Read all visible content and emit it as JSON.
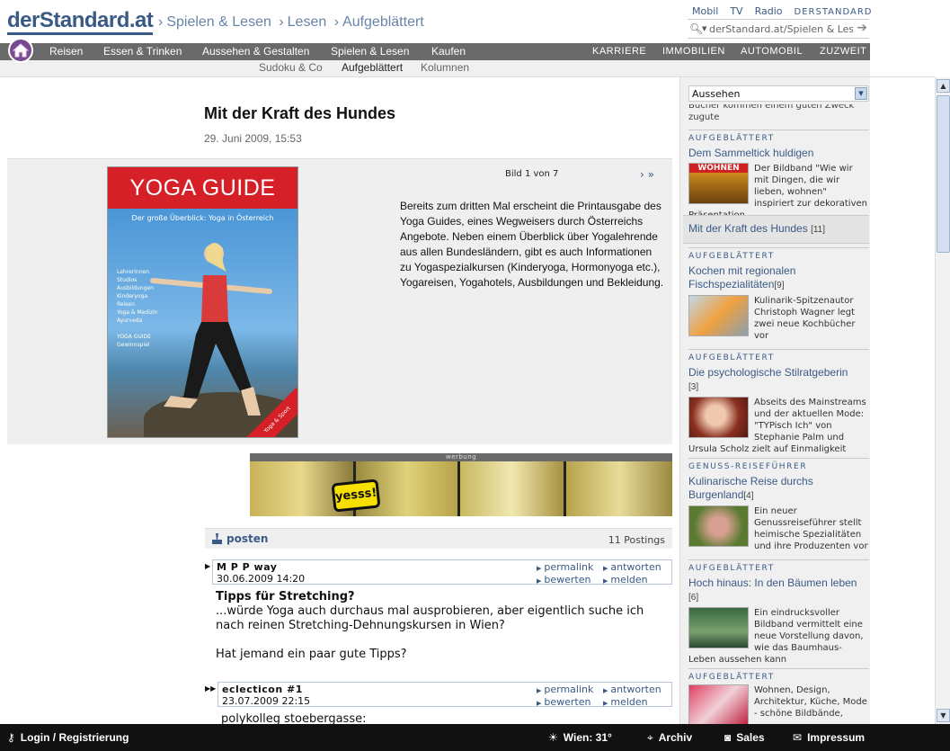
{
  "header": {
    "logo": "derStandard.at",
    "breadcrumbs": [
      "Spielen & Lesen",
      "Lesen",
      "Aufgeblättert"
    ],
    "separator": "›",
    "toplinks": [
      "Mobil",
      "TV",
      "Radio",
      "DERSTANDARD"
    ],
    "search_value": "derStandard.at/Spielen & Lesen"
  },
  "nav": {
    "items": [
      "Reisen",
      "Essen & Trinken",
      "Aussehen & Gestalten",
      "Spielen & Lesen",
      "Kaufen"
    ],
    "right_items": [
      "KARRIERE",
      "IMMOBILIEN",
      "AUTOMOBIL",
      "ZUZWEIT"
    ],
    "subitems": [
      "Sudoku & Co",
      "Aufgeblättert",
      "Kolumnen"
    ]
  },
  "article": {
    "title": "Mit der Kraft des Hundes",
    "date": "29. Juni 2009, 15:53",
    "gallery": {
      "counter": "Bild 1 von 7",
      "nav": "›  »",
      "caption": "Bereits zum dritten Mal erscheint die Printausgabe des Yoga Guides, eines Wegweisers durch Österreichs Angebote. Neben einem Überblick über Yogalehrende aus allen Bundesländern, gibt es auch Informationen zu Yogaspezialkursen (Kinderyoga, Hormonyoga etc.), Yogareisen, Yogahotels, Ausbildungen und Bekleidung."
    },
    "cover": {
      "title": "YOGA GUIDE",
      "subtitle": "Der große Überblick: Yoga in Österreich",
      "list": [
        "Lehrerinnen",
        "Studios",
        "Ausbildungen",
        "Kinderyoga",
        "Reisen",
        "Yoga & Medizin",
        "Ayurveda",
        "",
        "YOGA GUIDE",
        "Gewinnspiel"
      ],
      "corner": "Yoga & Sport"
    }
  },
  "ad": {
    "label": "werbung",
    "brand": "yesss!"
  },
  "comments": {
    "post_label": "posten",
    "count": "11 Postings",
    "actions": [
      "permalink",
      "antworten",
      "bewerten",
      "melden"
    ],
    "posts": [
      {
        "user": "M P P way",
        "time": "30.06.2009 14:20",
        "title": "Tipps für Stretching?",
        "text": "...würde Yoga auch durchaus mal ausprobieren, aber eigentlich suche ich nach reinen Stretching-Dehnungskursen in Wien?",
        "text2": "Hat jemand ein paar gute Tipps?"
      },
      {
        "user": "eclecticon #1",
        "time": "23.07.2009 22:15",
        "text": "polykolleg stoebergasse:"
      }
    ]
  },
  "sidebar": {
    "select_value": "Aussehen",
    "cut_text": "Bücher kommen einem guten Zweck zugute",
    "sections": [
      {
        "kicker": "AUFGEBLÄTTERT",
        "title": "Dem Sammeltick huldigen",
        "count": "",
        "thumb_text": "WOHNEN",
        "teaser": "Der Bildband \"Wie wir mit Dingen, die wir lieben, wohnen\" inspiriert zur dekorativen Präsentation"
      },
      {
        "kicker": "AUFGEBLÄTTERT",
        "title": "Kochen mit regionalen Fischspezialitäten",
        "count": "[9]",
        "teaser": "Kulinarik-Spitzenautor Christoph Wagner legt zwei neue Kochbücher vor"
      },
      {
        "kicker": "AUFGEBLÄTTERT",
        "title": "Die psychologische Stilratgeberin",
        "count": "[3]",
        "teaser": "Abseits des Mainstreams und der aktuellen Mode: \"TYPisch Ich\" von Stephanie Palm und Ursula Scholz zielt auf Einmaligkeit"
      },
      {
        "kicker": "GENUSS-REISEFÜHRER",
        "title": "Kulinarische Reise durchs Burgenland",
        "count": "[4]",
        "teaser": "Ein neuer Genussreiseführer stellt heimische Spezialitäten und ihre Produzenten vor"
      },
      {
        "kicker": "AUFGEBLÄTTERT",
        "title": "Hoch hinaus: In den Bäumen leben",
        "count": "[6]",
        "teaser": "Ein eindrucksvoller Bildband vermittelt eine neue Vorstellung davon, wie das Baumhaus-Leben aussehen kann"
      },
      {
        "kicker": "AUFGEBLÄTTERT",
        "title": "",
        "count": "",
        "teaser": "Wohnen, Design, Architektur, Küche, Mode - schöne Bildbände,"
      }
    ],
    "current": {
      "title": "Mit der Kraft des Hundes",
      "count": "[11]"
    }
  },
  "bottombar": {
    "login": "Login / Registrierung",
    "weather": "Wien: 31°",
    "archiv": "Archiv",
    "sales": "Sales",
    "impressum": "Impressum"
  }
}
